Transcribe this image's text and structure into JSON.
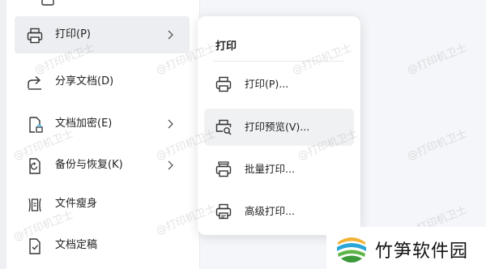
{
  "colors": {
    "background": "#f4f6f9",
    "menu_bg": "#ffffff",
    "active_bg": "#eceef1",
    "icon_stroke": "#333333",
    "brand_blue": "#2aa7d8",
    "brand_green": "#5fb548",
    "brand_yellow": "#f2b233"
  },
  "main_menu": {
    "items": [
      {
        "label": "打印(P)",
        "icon": "printer-icon",
        "has_submenu": true,
        "active": true
      },
      {
        "label": "分享文档(D)",
        "icon": "share-icon",
        "has_submenu": false
      },
      {
        "label": "文档加密(E)",
        "icon": "document-lock-icon",
        "has_submenu": true
      },
      {
        "label": "备份与恢复(K)",
        "icon": "backup-icon",
        "has_submenu": true
      },
      {
        "label": "文件瘦身",
        "icon": "file-slim-icon",
        "has_submenu": false
      },
      {
        "label": "文档定稿",
        "icon": "document-final-icon",
        "has_submenu": false
      }
    ]
  },
  "submenu": {
    "title": "打印",
    "items": [
      {
        "label": "打印(P)...",
        "icon": "printer-icon"
      },
      {
        "label": "打印预览(V)...",
        "icon": "print-preview-icon",
        "active": true
      },
      {
        "label": "批量打印...",
        "icon": "batch-print-icon"
      },
      {
        "label": "高级打印...",
        "icon": "advanced-print-icon"
      }
    ]
  },
  "watermark_text": "@打印机卫士",
  "brand": {
    "name": "竹笋软件园",
    "logo": "bamboo-logo"
  }
}
